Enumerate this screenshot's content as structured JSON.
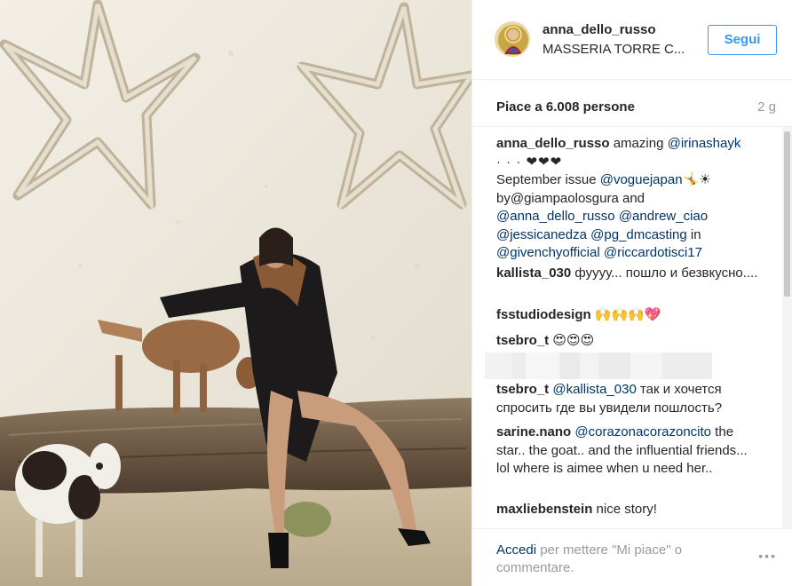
{
  "post": {
    "username": "anna_dello_russo",
    "location": "MASSERIA TORRE C...",
    "follow_label": "Segui",
    "likes": "Piace a 6.008 persone",
    "time": "2 g"
  },
  "caption": {
    "user": "anna_dello_russo",
    "t1": " amazing ",
    "m1": "@irinashayk",
    "t2": "· · · ❤❤❤",
    "t3": "September issue ",
    "m2": "@voguejapan",
    "t4": "🤸☀",
    "t5": "by@giampaolosgura and",
    "m3": "@anna_dello_russo",
    "m4": "@andrew_ciao",
    "m5": "@jessicanedza",
    "m6": "@pg_dmcasting",
    "t6": " in",
    "m7": "@givenchyofficial",
    "m8": "@riccardotisci17"
  },
  "comments": [
    {
      "user": "kallista_030",
      "text": " фуууу... пошло и безвкусно...."
    },
    {
      "user": "fsstudiodesign",
      "text": " 🙌🙌🙌💖"
    },
    {
      "user": "tsebro_t",
      "text": " 😍😍😍"
    },
    {
      "user": "tsebro_t",
      "mention": "@kallista_030",
      "text": " так и хочется спросить где вы увидели пошлость?"
    },
    {
      "user": "sarine.nano",
      "mention": "@corazonacorazoncito",
      "text": " the star.. the goat.. and the influential friends... lol where is aimee when u need her.."
    },
    {
      "user": "maxliebenstein",
      "text": " nice story!"
    }
  ],
  "footer": {
    "login": "Accedi",
    "rest": " per mettere \"Mi piace\" o commentare.",
    "more": "•••"
  },
  "colors": {
    "accent_blue": "#3897f0",
    "link_dark_blue": "#003569",
    "muted_text": "#999999",
    "divider": "#efefef"
  },
  "icons": {
    "avatar": "religious-icon-avatar",
    "more": "ellipsis-icon"
  }
}
